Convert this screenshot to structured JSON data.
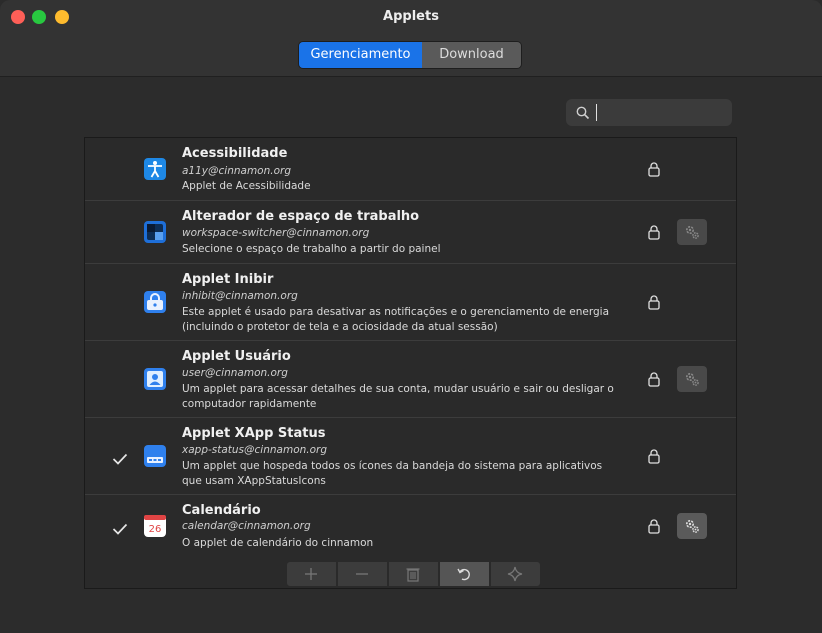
{
  "window": {
    "title": "Applets"
  },
  "tabs": [
    {
      "label": "Gerenciamento",
      "active": true
    },
    {
      "label": "Download",
      "active": false
    }
  ],
  "search": {
    "value": "",
    "icon": "search-icon"
  },
  "applets": [
    {
      "name": "Acessibilidade",
      "uuid": "a11y@cinnamon.org",
      "description": "Applet de Acessibilidade",
      "enabled": false,
      "has_settings": false,
      "icon": "accessibility-icon",
      "icon_color": "#1e88e5"
    },
    {
      "name": "Alterador de espaço de trabalho",
      "uuid": "workspace-switcher@cinnamon.org",
      "description": "Selecione o espaço de trabalho a partir do painel",
      "enabled": false,
      "has_settings": true,
      "icon": "workspace-switcher-icon",
      "icon_color": "#1e6fd9"
    },
    {
      "name": "Applet Inibir",
      "uuid": "inhibit@cinnamon.org",
      "description": "Este applet é usado para desativar as notificações e o gerenciamento de energia (incluindo o protetor de tela e a ociosidade da atual sessão)",
      "enabled": false,
      "has_settings": false,
      "icon": "inhibit-lock-icon",
      "icon_color": "#2f80ed"
    },
    {
      "name": "Applet Usuário",
      "uuid": "user@cinnamon.org",
      "description": "Um applet para acessar detalhes de sua conta, mudar usuário e sair ou desligar o computador rapidamente",
      "enabled": false,
      "has_settings": true,
      "icon": "user-account-icon",
      "icon_color": "#2f80ed"
    },
    {
      "name": "Applet XApp Status",
      "uuid": "xapp-status@cinnamon.org",
      "description": "Um applet que hospeda todos os ícones da bandeja do sistema para aplicativos que usam XAppStatusIcons",
      "enabled": true,
      "has_settings": false,
      "icon": "xapp-status-icon",
      "icon_color": "#2f80ed"
    },
    {
      "name": "Calendário",
      "uuid": "calendar@cinnamon.org",
      "description": "O applet de calendário do cinnamon",
      "enabled": true,
      "has_settings": true,
      "icon": "calendar-icon",
      "icon_color": "#ffffff",
      "icon_text": "26"
    }
  ],
  "toolbar": {
    "buttons": [
      {
        "name": "add-button",
        "icon": "plus-icon",
        "enabled": false
      },
      {
        "name": "remove-button",
        "icon": "minus-icon",
        "enabled": false
      },
      {
        "name": "uninstall-button",
        "icon": "trash-icon",
        "enabled": false
      },
      {
        "name": "restore-button",
        "icon": "undo-icon",
        "enabled": true
      },
      {
        "name": "more-button",
        "icon": "sparkle-icon",
        "enabled": false
      }
    ]
  }
}
